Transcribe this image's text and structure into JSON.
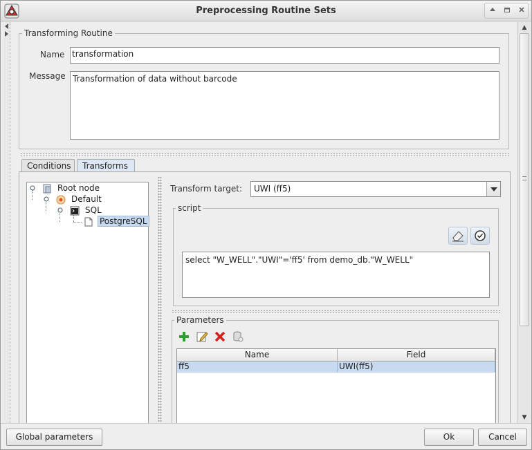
{
  "window": {
    "title": "Preprocessing Routine Sets"
  },
  "routine": {
    "group_label": "Transforming Routine",
    "name_label": "Name",
    "name_value": "transformation",
    "message_label": "Message",
    "message_value": "Transformation of data without barcode"
  },
  "tabs": [
    {
      "label": "Conditions",
      "active": false
    },
    {
      "label": "Transforms",
      "active": true
    }
  ],
  "tree": {
    "root": "Root node",
    "default": "Default",
    "sql": "SQL",
    "postgres": "PostgreSQL"
  },
  "transform": {
    "target_label": "Transform target:",
    "target_value": "UWI (ff5)",
    "script_label": "script",
    "script_value": "select \"W_WELL\".\"UWI\"='ff5' from demo_db.\"W_WELL\""
  },
  "parameters": {
    "group_label": "Parameters",
    "columns": [
      "Name",
      "Field"
    ],
    "rows": [
      {
        "name": "ff5",
        "field": "UWI(ff5)"
      }
    ]
  },
  "footer": {
    "global_params": "Global parameters",
    "ok": "Ok",
    "cancel": "Cancel"
  },
  "colors": {
    "selection": "#c8daef",
    "add_icon": "#2e9e2e",
    "delete_icon": "#d22020"
  }
}
